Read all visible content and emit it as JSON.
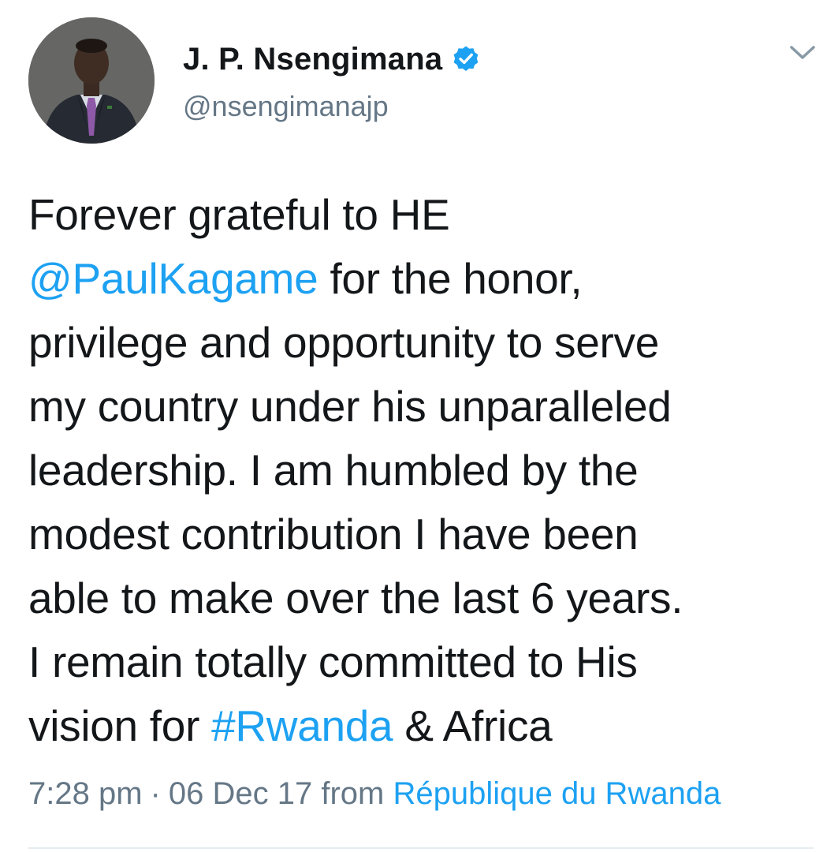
{
  "colors": {
    "link": "#1da1f2",
    "text": "#14171a",
    "secondary": "#657786",
    "verified": "#1da1f2"
  },
  "author": {
    "display_name": "J. P. Nsengimana",
    "handle": "@nsengimanajp",
    "verified_icon": "verified-badge-icon",
    "menu_icon": "chevron-down-icon"
  },
  "tweet": {
    "lines": [
      [
        {
          "text": "Forever grateful to HE"
        }
      ],
      [
        {
          "text": "@PaulKagame",
          "link": true
        },
        {
          "text": " for the honor,"
        }
      ],
      [
        {
          "text": "privilege and opportunity to serve"
        }
      ],
      [
        {
          "text": "my country under his unparalleled"
        }
      ],
      [
        {
          "text": "leadership. I am humbled by the"
        }
      ],
      [
        {
          "text": "modest contribution I have been"
        }
      ],
      [
        {
          "text": "able to make over the last 6 years."
        }
      ],
      [
        {
          "text": "I remain totally committed to His"
        }
      ],
      [
        {
          "text": "vision for "
        },
        {
          "text": "#Rwanda",
          "link": true
        },
        {
          "text": " & Africa"
        }
      ]
    ]
  },
  "meta": {
    "time": "7:28 pm",
    "separator": "·",
    "date": "06 Dec 17",
    "from_label": "from",
    "source": "République du Rwanda"
  }
}
